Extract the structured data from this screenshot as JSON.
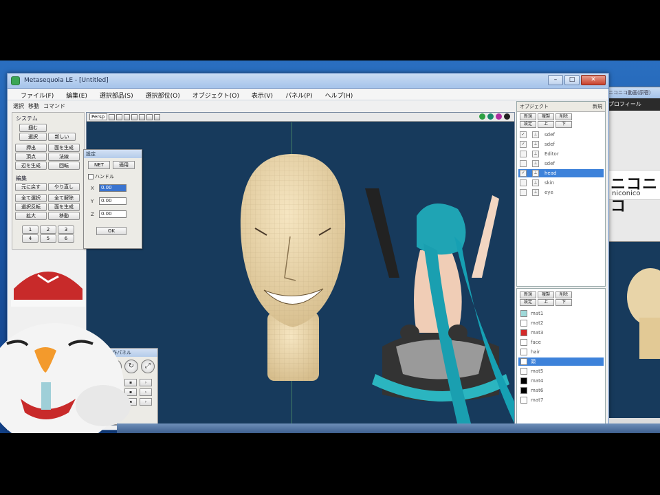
{
  "window": {
    "title": "Metasequoia LE - [Untitled]",
    "controls": {
      "minimize": "–",
      "maximize": "□",
      "close": "✕"
    }
  },
  "menus": [
    "ファイル(F)",
    "編集(E)",
    "選択部品(S)",
    "選択部位(O)",
    "オブジェクト(O)",
    "表示(V)",
    "パネル(P)",
    "ヘルプ(H)"
  ],
  "toolbar": {
    "select_label": "選択",
    "move_label": "移動",
    "tool_label": "コマンド"
  },
  "tool_panel": {
    "title": "システム",
    "buttons": [
      "掴む",
      "選択",
      "新しい",
      "押出",
      "面を生成",
      "頂点",
      "法線",
      "辺を生成",
      "回転",
      "拡大",
      "移動",
      "ナイフ"
    ],
    "edit_title": "編集",
    "edit_buttons": [
      "元に戻す",
      "やり直し",
      "全て選択",
      "全て解除",
      "選択反転",
      "面を生成"
    ],
    "number_buttons": [
      "1",
      "2",
      "3",
      "4",
      "5",
      "6"
    ]
  },
  "viewport": {
    "view_mode": "Persp",
    "indicator_colors": [
      "#2ea043",
      "#1a8a6a",
      "#b02ca0",
      "#222222"
    ]
  },
  "coord_dialog": {
    "title": "設定",
    "btn_left": "NET",
    "btn_right": "適用",
    "checkbox_label": "ハンドル",
    "fields": [
      {
        "label": "X",
        "value": "0.00"
      },
      {
        "label": "Y",
        "value": "0.00"
      },
      {
        "label": "Z",
        "value": "0.00"
      }
    ],
    "ok_label": "OK"
  },
  "op_panel": {
    "title": "操作パネル",
    "circle_icons": [
      "✥",
      "↻",
      "⤢"
    ]
  },
  "object_panel": {
    "tabs": [
      "オブジェクト",
      "新規"
    ],
    "header_buttons": [
      "新規",
      "複製",
      "削除",
      "設定",
      "上",
      "下"
    ],
    "objects": [
      {
        "name": "sdef",
        "visible": "✓",
        "lock": "⊥",
        "selected": false
      },
      {
        "name": "sdef",
        "visible": "✓",
        "lock": "⊥",
        "selected": false
      },
      {
        "name": "Editor",
        "visible": "",
        "lock": "⊥",
        "selected": false
      },
      {
        "name": "sdef",
        "visible": "",
        "lock": "⊥",
        "selected": false
      },
      {
        "name": "head",
        "visible": "✓",
        "lock": "⊥",
        "selected": true
      },
      {
        "name": "skin",
        "visible": "",
        "lock": "⊥",
        "selected": false
      },
      {
        "name": "eye",
        "visible": "",
        "lock": "⊥",
        "selected": false
      }
    ]
  },
  "material_panel": {
    "header_buttons": [
      "新規",
      "複製",
      "削除",
      "設定",
      "上",
      "下"
    ],
    "materials": [
      {
        "name": "mat1",
        "color": "#9fd9d9",
        "selected": false
      },
      {
        "name": "mat2",
        "color": "#ffffff",
        "selected": false
      },
      {
        "name": "mat3",
        "color": "#d42a2a",
        "selected": false
      },
      {
        "name": "face",
        "color": "#ffffff",
        "selected": false
      },
      {
        "name": "hair",
        "color": "#ffffff",
        "selected": false
      },
      {
        "name": "頭",
        "color": "#ffffff",
        "selected": true
      },
      {
        "name": "mat5",
        "color": "#ffffff",
        "selected": false
      },
      {
        "name": "mat4",
        "color": "#000000",
        "selected": false
      },
      {
        "name": "mat6",
        "color": "#000000",
        "selected": false
      },
      {
        "name": "mat7",
        "color": "#ffffff",
        "selected": false
      }
    ]
  },
  "back_window": {
    "title": "ニコニコ動画(原宿)",
    "nav": "プロフィール",
    "logo_big": "ニコニコ",
    "logo_small": "niconico"
  }
}
